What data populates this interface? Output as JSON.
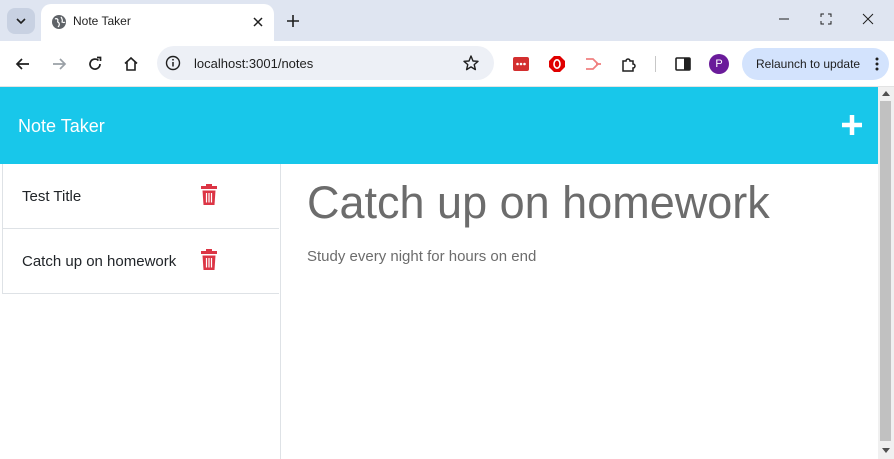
{
  "browser": {
    "tab_title": "Note Taker",
    "url": "localhost:3001/notes",
    "relaunch_label": "Relaunch to update",
    "profile_initial": "P",
    "icons": [
      "tab-search-icon",
      "globe-icon",
      "close-icon",
      "plus-icon",
      "minimize-icon",
      "maximize-icon",
      "back-icon",
      "forward-icon",
      "reload-icon",
      "home-icon",
      "info-icon",
      "star-icon",
      "extension-icons",
      "puzzle-icon",
      "sidebar-icon",
      "kebab-menu-icon"
    ]
  },
  "app": {
    "brand": "Note Taker",
    "accent_color": "#18c7ea",
    "delete_color": "#dc3545"
  },
  "notes": [
    {
      "title": "Test Title"
    },
    {
      "title": "Catch up on homework"
    }
  ],
  "active_note": {
    "title": "Catch up on homework",
    "text": "Study every night for hours on end"
  }
}
